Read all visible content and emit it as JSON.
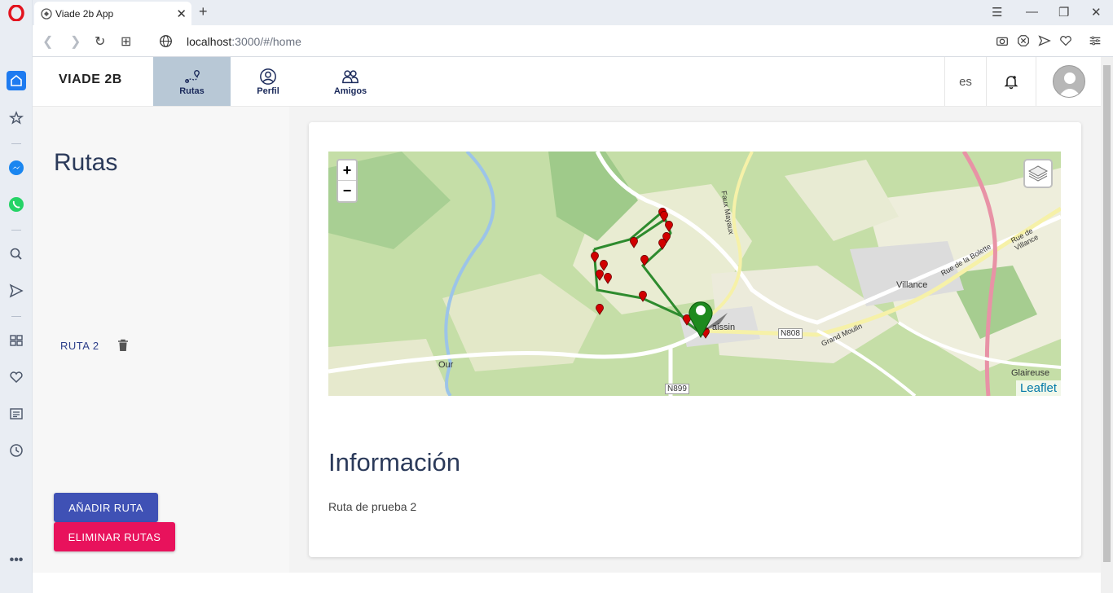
{
  "browser": {
    "tab_title": "Viade 2b App",
    "url_host": "localhost",
    "url_path": ":3000/#/home"
  },
  "app": {
    "brand": "VIADE 2B",
    "nav": [
      {
        "label": "Rutas",
        "active": true
      },
      {
        "label": "Perfil",
        "active": false
      },
      {
        "label": "Amigos",
        "active": false
      }
    ],
    "language": "es"
  },
  "sidebar": {
    "title": "Rutas",
    "routes": [
      {
        "label": "RUTA 2"
      }
    ],
    "add_button": "AÑADIR RUTA",
    "delete_button": "ELIMINAR RUTAS"
  },
  "map": {
    "zoom_in": "+",
    "zoom_out": "−",
    "attribution": "Leaflet",
    "place_labels": [
      "Villance",
      "Glaireuse",
      "Our",
      "N808",
      "N899",
      "Grand Moulin",
      "Rue de Villance",
      "Rue de la Bolette",
      "Faux Mayaux",
      "aissin"
    ],
    "route_color": "#2e8b2e",
    "marker_color": "#d10000",
    "start_marker_color": "#1e8a1e"
  },
  "info": {
    "title": "Información",
    "description": "Ruta de prueba 2"
  }
}
